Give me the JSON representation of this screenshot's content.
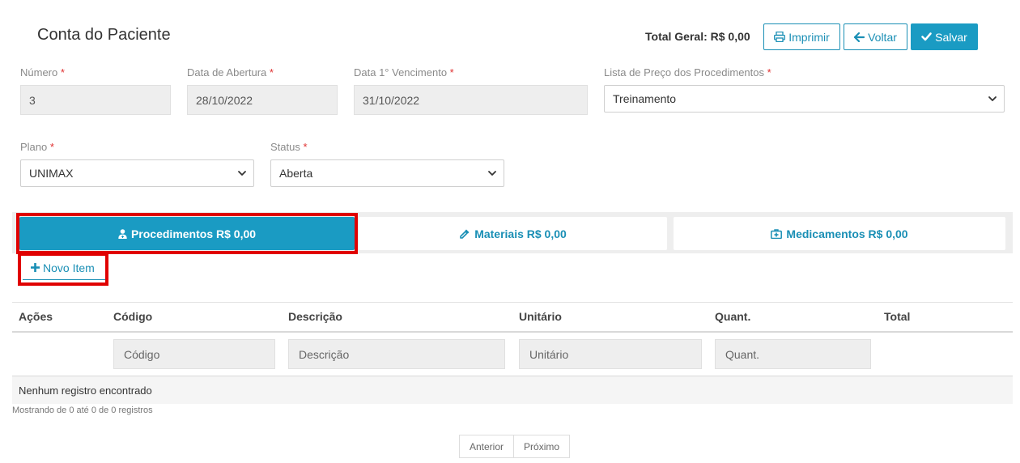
{
  "header": {
    "title": "Conta do Paciente",
    "total_label": "Total Geral: R$ 0,00",
    "print_label": "Imprimir",
    "back_label": "Voltar",
    "save_label": "Salvar"
  },
  "form": {
    "numero": {
      "label": "Número",
      "value": "3"
    },
    "data_abertura": {
      "label": "Data de Abertura",
      "value": "28/10/2022"
    },
    "data_vencimento": {
      "label": "Data 1° Vencimento",
      "value": "31/10/2022"
    },
    "lista_preco": {
      "label": "Lista de Preço dos Procedimentos",
      "value": "Treinamento"
    },
    "plano": {
      "label": "Plano",
      "value": "UNIMAX"
    },
    "status": {
      "label": "Status",
      "value": "Aberta"
    },
    "required_mark": "*"
  },
  "tabs": [
    {
      "label": "Procedimentos R$ 0,00",
      "icon": "user-md-icon",
      "active": true
    },
    {
      "label": "Materiais R$ 0,00",
      "icon": "eyedropper-icon",
      "active": false
    },
    {
      "label": "Medicamentos R$ 0,00",
      "icon": "medkit-icon",
      "active": false
    }
  ],
  "new_item_label": "Novo Item",
  "table": {
    "columns": [
      "Ações",
      "Código",
      "Descrição",
      "Unitário",
      "Quant.",
      "Total"
    ],
    "filters": {
      "codigo": "Código",
      "descricao": "Descrição",
      "unitario": "Unitário",
      "quant": "Quant."
    },
    "empty_message": "Nenhum registro encontrado",
    "info": "Mostrando de 0 até 0 de 0 registros"
  },
  "pagination": {
    "prev": "Anterior",
    "next": "Próximo"
  },
  "colors": {
    "accent": "#1a9bc3",
    "highlight": "#e00000",
    "required": "#e03131"
  }
}
